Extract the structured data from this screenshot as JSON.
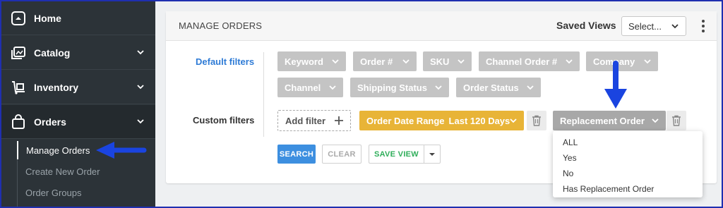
{
  "sidebar": {
    "items": [
      {
        "label": "Home",
        "icon": "home-icon"
      },
      {
        "label": "Catalog",
        "icon": "catalog-icon"
      },
      {
        "label": "Inventory",
        "icon": "inventory-icon"
      },
      {
        "label": "Orders",
        "icon": "orders-bag-icon"
      }
    ],
    "sub_items": [
      "Manage Orders",
      "Create New Order",
      "Order Groups"
    ]
  },
  "panel": {
    "title": "MANAGE ORDERS",
    "saved_views_label": "Saved Views",
    "saved_views_value": "Select..."
  },
  "filters": {
    "default_label": "Default filters",
    "custom_label": "Custom filters",
    "default_chips": [
      "Keyword",
      "Order #",
      "SKU",
      "Channel Order #",
      "Company",
      "Channel",
      "Shipping Status",
      "Order Status"
    ],
    "add_filter_label": "Add filter",
    "date_range_name": "Order Date Range",
    "date_range_value": "Last 120 Days",
    "replacement_label": "Replacement Order"
  },
  "actions": {
    "search": "SEARCH",
    "clear": "CLEAR",
    "save_view": "SAVE VIEW"
  },
  "replacement_dropdown": {
    "options": [
      "ALL",
      "Yes",
      "No",
      "Has Replacement Order"
    ]
  },
  "colors": {
    "sidebar_bg": "#2c3338",
    "link_blue": "#2e7bd6",
    "chip_grey": "#c4c4c4",
    "chip_orange": "#e8b437",
    "search_blue": "#3d8fe0",
    "save_green": "#2fae5a",
    "annotation_arrow": "#1a44e0"
  }
}
